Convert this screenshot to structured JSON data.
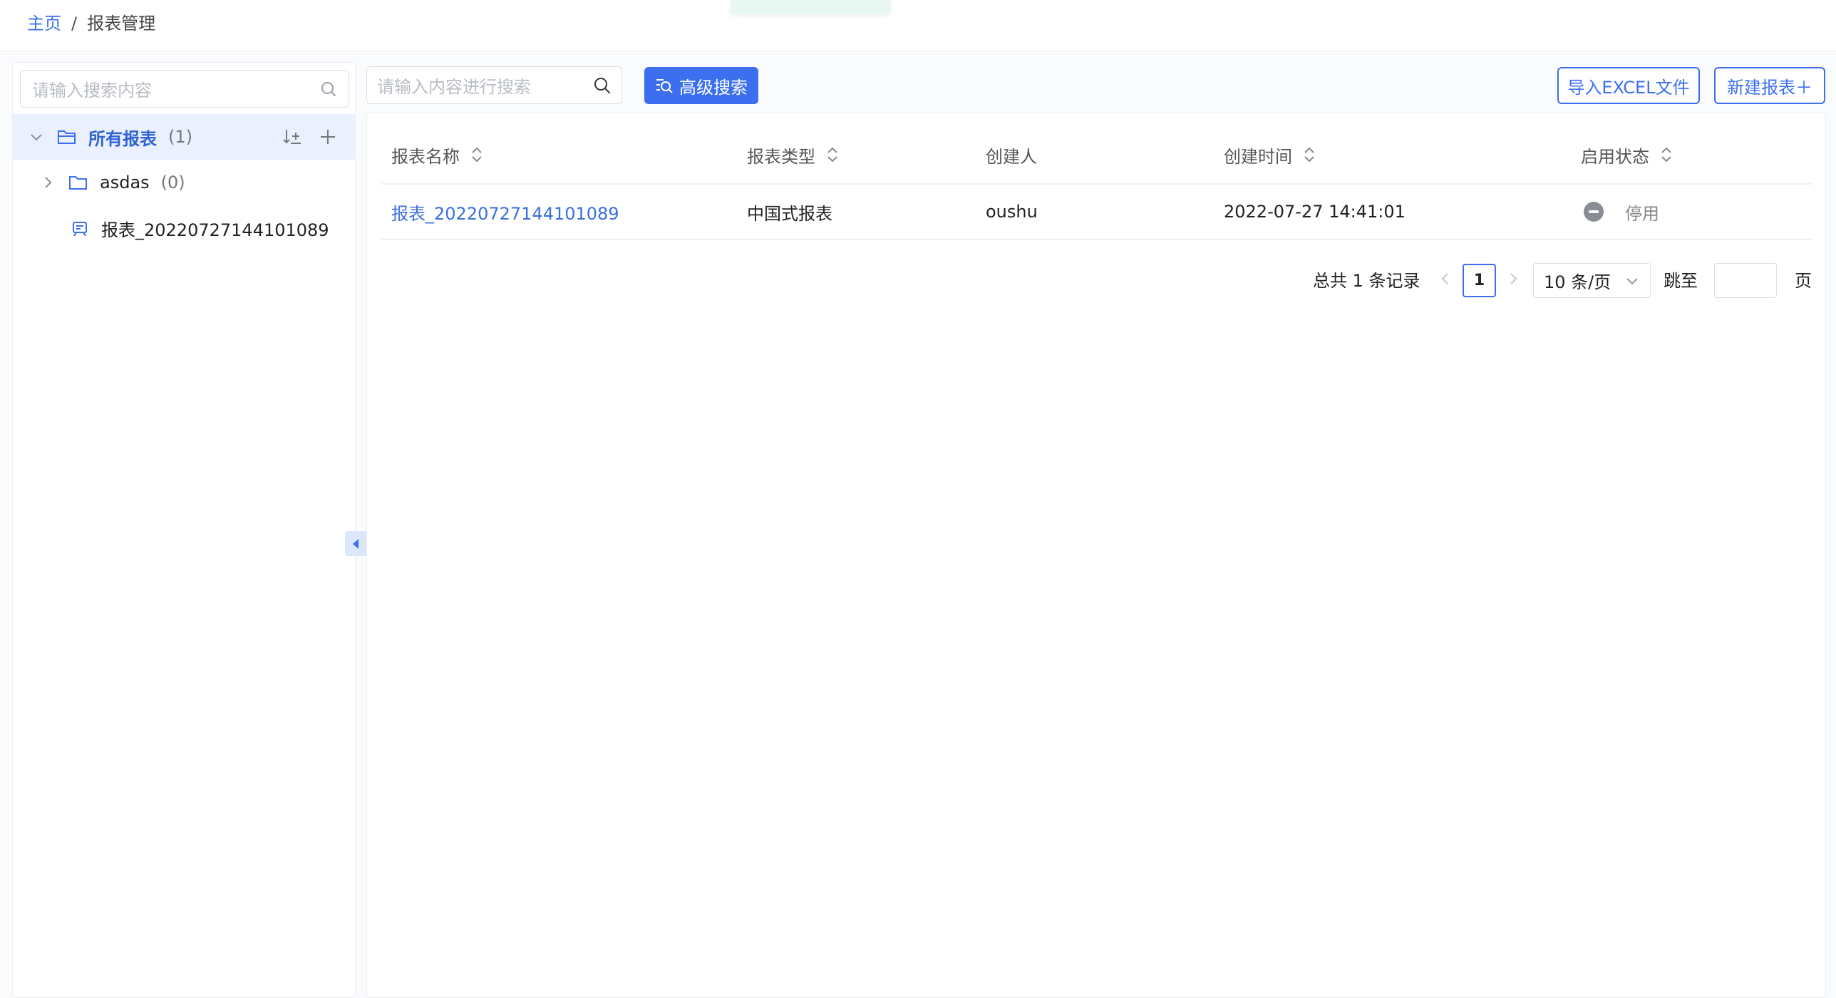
{
  "breadcrumb": {
    "home": "主页",
    "separator": "/",
    "current": "报表管理"
  },
  "sidebar": {
    "search_placeholder": "请输入搜索内容",
    "tree": [
      {
        "label": "所有报表",
        "count": "(1)",
        "expanded": true,
        "active": true,
        "icon": "folder-open-icon"
      },
      {
        "label": "asdas",
        "count": "(0)",
        "expanded": false,
        "icon": "folder-icon"
      },
      {
        "label": "报表_20220727144101089",
        "icon": "report-icon"
      }
    ]
  },
  "toolbar": {
    "search_placeholder": "请输入内容进行搜索",
    "advanced_search": "高级搜索",
    "import_excel": "导入EXCEL文件",
    "new_report": "新建报表＋"
  },
  "table": {
    "columns": [
      "报表名称",
      "报表类型",
      "创建人",
      "创建时间",
      "启用状态"
    ],
    "rows": [
      {
        "name": "报表_20220727144101089",
        "type": "中国式报表",
        "creator": "oushu",
        "created": "2022-07-27 14:41:01",
        "status": "停用"
      }
    ]
  },
  "pagination": {
    "total": "总共 1 条记录",
    "current_page": "1",
    "page_size": "10 条/页",
    "jump_label": "跳至",
    "page_suffix": "页"
  },
  "colors": {
    "accent": "#3b6ff0",
    "active_bg": "#eaf0fd",
    "status_disabled": "#8a8d93"
  }
}
